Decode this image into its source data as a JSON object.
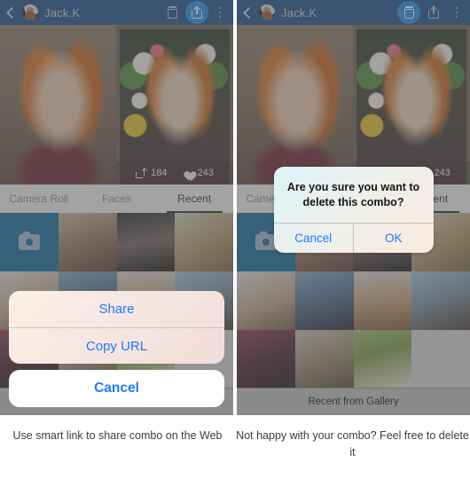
{
  "navbar": {
    "back_icon": "chevron-left-icon",
    "avatar": "user-avatar",
    "title": "Jack.K",
    "trash_icon": "trash-icon",
    "share_icon": "share-icon",
    "overflow_icon": "kebab-menu-icon"
  },
  "hero": {
    "reshare_count": "184",
    "like_count": "243",
    "reshare_icon": "reshare-icon",
    "heart_icon": "heart-icon"
  },
  "tabs": [
    {
      "label": "Camera Roll",
      "active": false
    },
    {
      "label": "Faces",
      "active": false
    },
    {
      "label": "Recent",
      "active": true
    }
  ],
  "gallery": {
    "camera_tile": "camera-icon"
  },
  "left_panel": {
    "action_sheet": {
      "options": [
        {
          "label": "Share"
        },
        {
          "label": "Copy URL"
        }
      ],
      "cancel_label": "Cancel"
    }
  },
  "right_panel": {
    "alert": {
      "message": "Are you sure you want to delete this combo?",
      "cancel_label": "Cancel",
      "confirm_label": "OK"
    },
    "bottom_bar_label": "Recent from Gallery"
  },
  "captions": {
    "left": "Use smart link to share combo on the Web",
    "right": "Not happy with your combo? Feel free to delete it"
  },
  "colors": {
    "navbar_bg": "#1b4f8a",
    "accent_blue": "#1e8fe8",
    "ios_blue": "#1d7bfb",
    "camera_tile": "#106a9e"
  }
}
